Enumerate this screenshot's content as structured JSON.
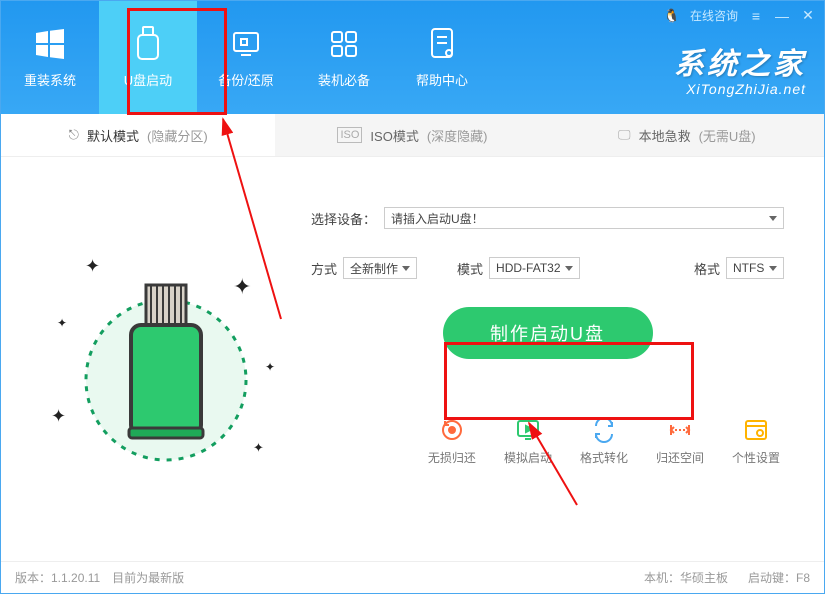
{
  "titlebar": {
    "consult": "在线咨询"
  },
  "nav": {
    "items": [
      {
        "label": "重装系统"
      },
      {
        "label": "U盘启动"
      },
      {
        "label": "备份/还原"
      },
      {
        "label": "装机必备"
      },
      {
        "label": "帮助中心"
      }
    ]
  },
  "logo": {
    "main": "系统之家",
    "sub": "XiTongZhiJia.net"
  },
  "modes": {
    "items": [
      {
        "title": "默认模式",
        "hint": "(隐藏分区)"
      },
      {
        "title": "ISO模式",
        "hint": "(深度隐藏)"
      },
      {
        "title": "本地急救",
        "hint": "(无需U盘)"
      }
    ]
  },
  "form": {
    "device_label": "选择设备：",
    "device_value": "请插入启动U盘！",
    "method_label": "方式",
    "method_value": "全新制作",
    "mode_label": "模式",
    "mode_value": "HDD-FAT32",
    "format_label": "格式",
    "format_value": "NTFS",
    "big_button": "制作启动U盘"
  },
  "tools": {
    "items": [
      {
        "label": "无损归还",
        "color": "#ff6a3d"
      },
      {
        "label": "模拟启动",
        "color": "#2dc96f"
      },
      {
        "label": "格式转化",
        "color": "#4aa8f0"
      },
      {
        "label": "归还空间",
        "color": "#ff6a3d"
      },
      {
        "label": "个性设置",
        "color": "#ffb300"
      }
    ]
  },
  "footer": {
    "version": "版本：1.1.20.11",
    "status": "目前为最新版",
    "board": "本机：华硕主板",
    "bootkey": "启动键：F8"
  }
}
